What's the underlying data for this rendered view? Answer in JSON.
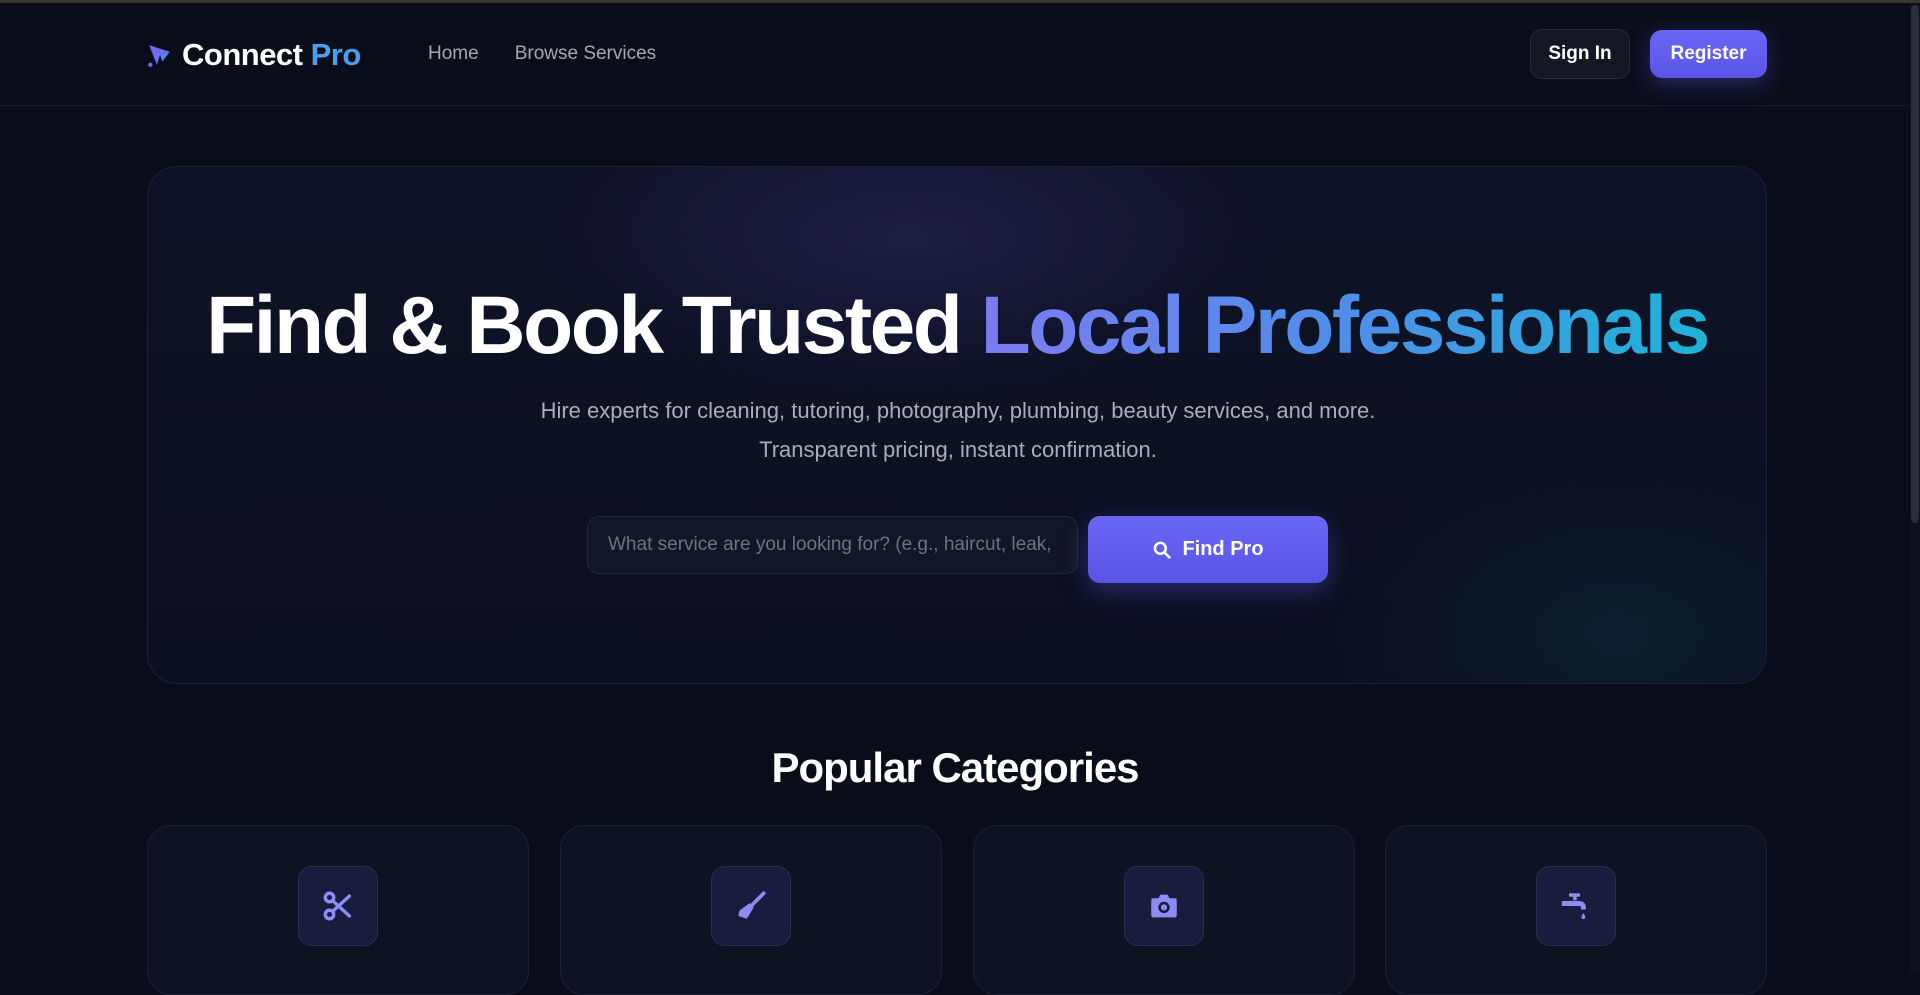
{
  "brand": {
    "name_main": "Connect",
    "name_accent": "Pro",
    "icon": "send-arrow-icon",
    "accent_color": "#4a9ef0"
  },
  "nav": {
    "items": [
      {
        "label": "Home"
      },
      {
        "label": "Browse Services"
      }
    ]
  },
  "auth": {
    "signin_label": "Sign In",
    "register_label": "Register"
  },
  "hero": {
    "title_plain": "Find & Book Trusted ",
    "title_gradient": "Local Professionals",
    "subtitle": "Hire experts for cleaning, tutoring, photography, plumbing, beauty services, and more. Transparent pricing, instant confirmation.",
    "search": {
      "placeholder": "What service are you looking for? (e.g., haircut, leak, tutoring)",
      "value": ""
    },
    "find_button_label": "Find Pro",
    "find_button_icon": "search-icon"
  },
  "categories": {
    "title": "Popular Categories",
    "items": [
      {
        "icon": "scissors-icon",
        "label": ""
      },
      {
        "icon": "broom-icon",
        "label": ""
      },
      {
        "icon": "camera-icon",
        "label": ""
      },
      {
        "icon": "faucet-icon",
        "label": ""
      }
    ]
  },
  "colors": {
    "background": "#090d19",
    "primary": "#5e58ef",
    "gradient_start": "#7c7cf2",
    "gradient_end": "#1fb3d6"
  }
}
